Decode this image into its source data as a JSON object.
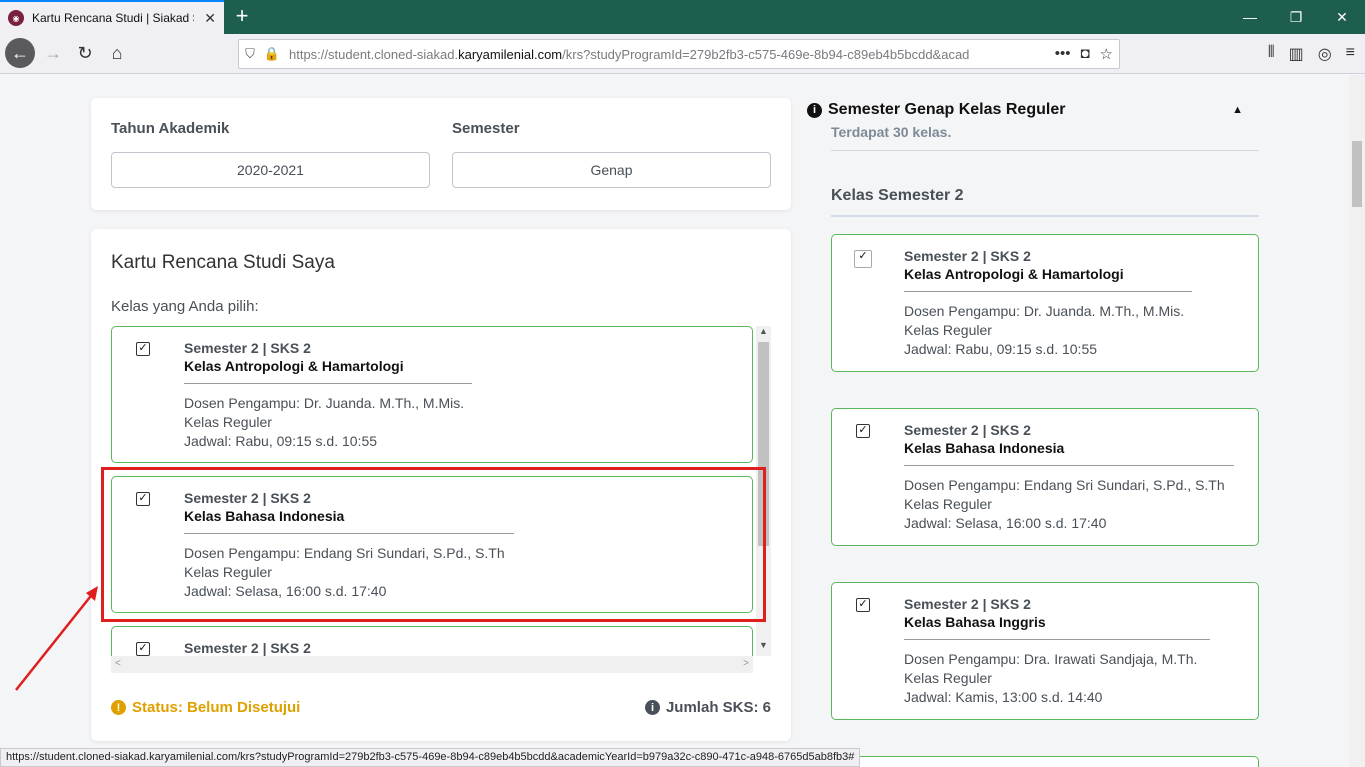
{
  "browser": {
    "tab_title": "Kartu Rencana Studi | Siakad ST",
    "url_prefix": "https://student.cloned-siakad.",
    "url_domain": "karyamilenial.com",
    "url_suffix": "/krs?studyProgramId=279b2fb3-c575-469e-8b94-c89eb4b5bcdd&acad",
    "status_url": "https://student.cloned-siakad.karyamilenial.com/krs?studyProgramId=279b2fb3-c575-469e-8b94-c89eb4b5bcdd&academicYearId=b979a32c-c890-471c-a948-6765d5ab8fb3#"
  },
  "filters": {
    "year_label": "Tahun Akademik",
    "year_value": "2020-2021",
    "semester_label": "Semester",
    "semester_value": "Genap"
  },
  "krs": {
    "title": "Kartu Rencana Studi Saya",
    "subtitle": "Kelas yang Anda pilih:",
    "status": "Status: Belum Disetujui",
    "total_sks": "Jumlah SKS: 6",
    "selected": [
      {
        "meta": "Semester 2 | SKS 2",
        "name": "Kelas Antropologi & Hamartologi",
        "dosen": "Dosen Pengampu: Dr. Juanda. M.Th., M.Mis.",
        "kelas": "Kelas Reguler",
        "jadwal": "Jadwal: Rabu, 09:15 s.d. 10:55"
      },
      {
        "meta": "Semester 2 | SKS 2",
        "name": "Kelas Bahasa Indonesia",
        "dosen": "Dosen Pengampu: Endang Sri Sundari, S.Pd., S.Th",
        "kelas": "Kelas Reguler",
        "jadwal": "Jadwal: Selasa, 16:00 s.d. 17:40"
      },
      {
        "meta": "Semester 2 | SKS 2"
      }
    ]
  },
  "available": {
    "header": "Semester Genap Kelas Reguler",
    "count": "Terdapat 30 kelas.",
    "section": "Kelas Semester 2",
    "items": [
      {
        "meta": "Semester 2 | SKS 2",
        "name": "Kelas Antropologi & Hamartologi",
        "dosen": "Dosen Pengampu: Dr. Juanda. M.Th., M.Mis.",
        "kelas": "Kelas Reguler",
        "jadwal": "Jadwal: Rabu, 09:15 s.d. 10:55"
      },
      {
        "meta": "Semester 2 | SKS 2",
        "name": "Kelas Bahasa Indonesia",
        "dosen": "Dosen Pengampu: Endang Sri Sundari, S.Pd., S.Th",
        "kelas": "Kelas Reguler",
        "jadwal": "Jadwal: Selasa, 16:00 s.d. 17:40"
      },
      {
        "meta": "Semester 2 | SKS 2",
        "name": "Kelas Bahasa Inggris",
        "dosen": "Dosen Pengampu: Dra. Irawati Sandjaja, M.Th.",
        "kelas": "Kelas Reguler",
        "jadwal": "Jadwal: Kamis, 13:00 s.d. 14:40"
      }
    ]
  },
  "colors": {
    "accent_green": "#5cb85c",
    "warning": "#e0a100",
    "annotation_red": "#e01e1e"
  }
}
